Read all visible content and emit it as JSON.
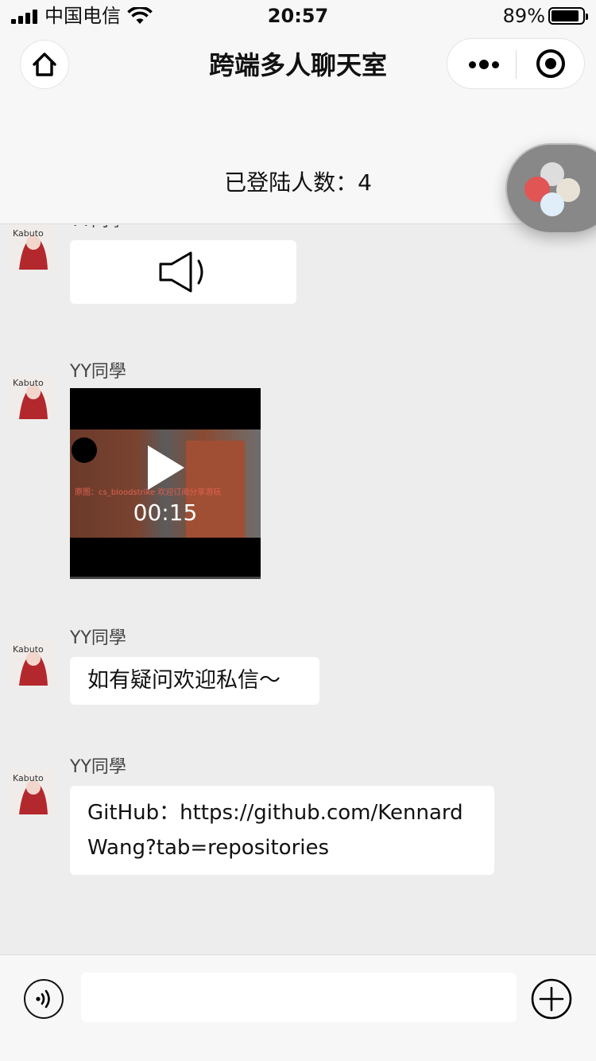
{
  "status_bar": {
    "carrier": "中国电信",
    "time": "20:57",
    "battery_percent": "89%",
    "battery_level": 0.89
  },
  "nav": {
    "title": "跨端多人聊天室",
    "home_icon": "home-icon",
    "more_icon": "more-dots-icon",
    "close_icon": "target-icon"
  },
  "room": {
    "online_label": "已登陆人数：4"
  },
  "messages": [
    {
      "sender": "YY同學",
      "type": "voice",
      "icon": "speaker-icon"
    },
    {
      "sender": "YY同學",
      "type": "video",
      "duration": "00:15",
      "overlay": "原图：cs_bloodstrike 欢迎订阅分享游玩"
    },
    {
      "sender": "YY同學",
      "type": "text",
      "text": "如有疑问欢迎私信～"
    },
    {
      "sender": "YY同學",
      "type": "text",
      "text": "GitHub：https://github.com/KennardWang?tab=repositories"
    }
  ],
  "footer": {
    "input_value": "",
    "input_placeholder": "",
    "voice_icon": "voice-icon",
    "plus_icon": "plus-icon"
  },
  "colors": {
    "page_bg": "#ededed",
    "bar_bg": "#f7f7f7",
    "bubble_bg": "#ffffff",
    "text": "#111111"
  }
}
